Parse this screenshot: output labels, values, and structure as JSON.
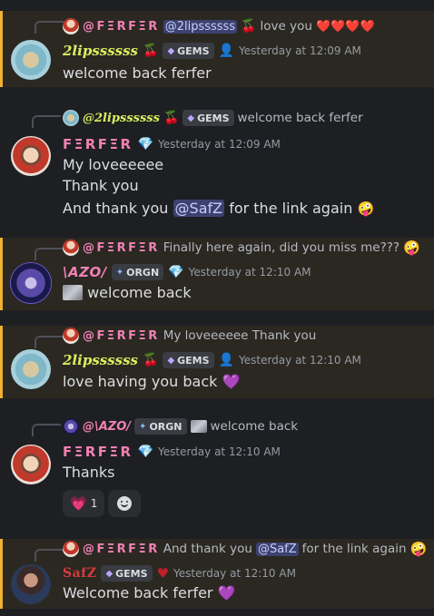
{
  "messages": [
    {
      "reply": {
        "name": "@FΞRFΞR",
        "mention": "@2lipssssss",
        "text": "love you",
        "emoji": "❤️❤️❤️❤️"
      },
      "author": "2lipssssss",
      "tag": "GEMS",
      "time": "Yesterday at 12:09 AM",
      "lines": [
        "welcome back ferfer"
      ]
    },
    {
      "reply": {
        "name": "@2lipssssss",
        "tag": "GEMS",
        "text": "welcome back ferfer"
      },
      "author": "FΞRFΞR",
      "time": "Yesterday at 12:09 AM",
      "lines": [
        "My loveeeeee",
        "Thank you",
        "And thank you",
        "for the link again"
      ],
      "mention": "@SafZ"
    },
    {
      "reply": {
        "name": "@FΞRFΞR",
        "text": "Finally here again, did you miss me???"
      },
      "author": "AZO",
      "tag": "ORGN",
      "time": "Yesterday at 12:10 AM",
      "lines": [
        "welcome back"
      ]
    },
    {
      "reply": {
        "name": "@FΞRFΞR",
        "text": "My loveeeeee Thank you"
      },
      "author": "2lipssssss",
      "tag": "GEMS",
      "time": "Yesterday at 12:10 AM",
      "lines": [
        "love having you back"
      ]
    },
    {
      "reply": {
        "name": "@AZO",
        "tag": "ORGN",
        "text": "welcome back"
      },
      "author": "FΞRFΞR",
      "time": "Yesterday at 12:10 AM",
      "lines": [
        "Thanks"
      ],
      "reactions": [
        {
          "emoji": "pink-heart",
          "count": "1"
        }
      ]
    },
    {
      "reply": {
        "name": "@FΞRFΞR",
        "text": "And thank you",
        "mention": "@SafZ",
        "text2": "for the link again"
      },
      "author": "SafZ",
      "tag": "GEMS",
      "time": "Yesterday at 12:10 AM",
      "lines": [
        "Welcome back ferfer"
      ]
    }
  ],
  "colors": {
    "background": "#1e1f22",
    "highlight": "#2b2822",
    "highlight_border": "#f0b232",
    "ferfer_name": "#f081b4",
    "twolips_name": "#d8f060",
    "safz_name": "#d63c3c",
    "mention_bg": "#3c4270",
    "timestamp": "#949ba4"
  },
  "icons": [
    "cherry-icon",
    "gem-icon",
    "purple-heart-icon",
    "pink-heart-icon",
    "smiley-icon",
    "add-reaction-icon",
    "diamond-tag-icon",
    "orgn-tag-icon"
  ]
}
